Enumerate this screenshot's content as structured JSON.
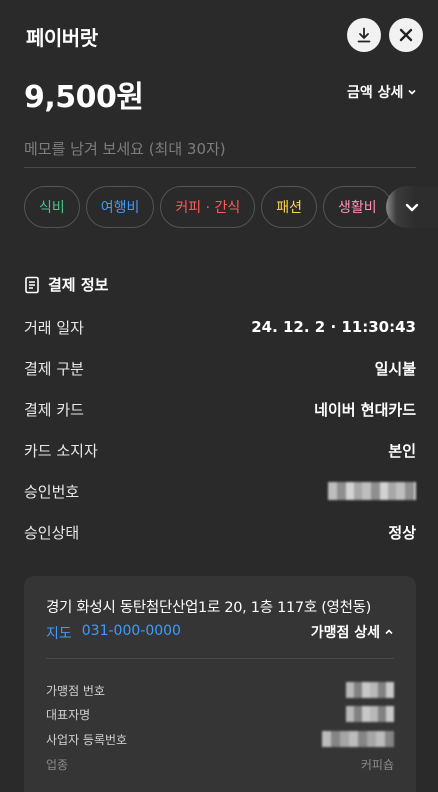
{
  "header": {
    "title": "페이버랏",
    "download_icon": "download-icon",
    "close_icon": "close-icon"
  },
  "amount": {
    "value": "9,500원",
    "detail_label": "금액 상세"
  },
  "memo": {
    "placeholder": "메모를 남겨 보세요 (최대 30자)"
  },
  "categories": [
    {
      "label": "식비",
      "color": "#4cc38a"
    },
    {
      "label": "여행비",
      "color": "#3e9bff"
    },
    {
      "label": "커피 · 간식",
      "color": "#ff5a5a"
    },
    {
      "label": "패션",
      "color": "#ffd54a"
    },
    {
      "label": "생활비",
      "color": "#ff8fb4"
    }
  ],
  "payment_info": {
    "title": "결제 정보",
    "rows": [
      {
        "label": "거래 일자",
        "value": "24. 12. 2 · 11:30:43"
      },
      {
        "label": "결제 구분",
        "value": "일시불"
      },
      {
        "label": "결제 카드",
        "value": "네이버 현대카드"
      },
      {
        "label": "카드 소지자",
        "value": "본인"
      },
      {
        "label": "승인번호",
        "value": ""
      },
      {
        "label": "승인상태",
        "value": "정상"
      }
    ]
  },
  "merchant": {
    "address": "경기 화성시 동탄첨단산업1로 20, 1층 117호 (영천동)",
    "map_label": "지도",
    "phone": "031-000-0000",
    "detail_label": "가맹점 상세",
    "info": [
      {
        "label": "가맹점 번호",
        "value": ""
      },
      {
        "label": "대표자명",
        "value": ""
      },
      {
        "label": "사업자 등록번호",
        "value": ""
      },
      {
        "label": "업종",
        "value": "커피숍"
      }
    ]
  }
}
